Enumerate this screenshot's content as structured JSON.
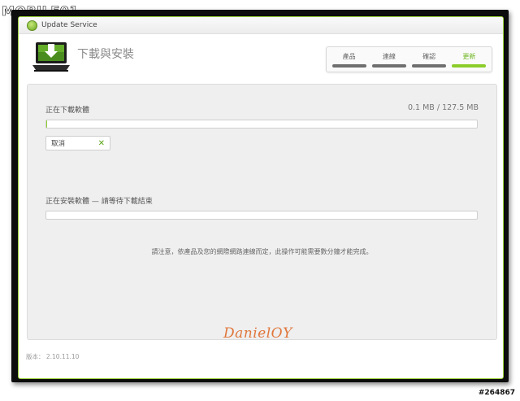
{
  "watermark": {
    "site_logo_text": "MOBILE01",
    "id_text": "#264867"
  },
  "window": {
    "title": "Update Service"
  },
  "header": {
    "page_title": "下載與安裝",
    "steps": [
      {
        "label": "產品",
        "active": false
      },
      {
        "label": "連線",
        "active": false
      },
      {
        "label": "確認",
        "active": false
      },
      {
        "label": "更新",
        "active": true
      }
    ],
    "colors": {
      "accent": "#8ccd2b",
      "inactive": "#6f6f6f"
    }
  },
  "download": {
    "label": "正在下載軟體",
    "size_text": "0.1 MB / 127.5 MB",
    "progress": 0.001,
    "cancel_label": "取消"
  },
  "install": {
    "label": "正在安裝軟體 — 請等待下載結束",
    "progress": 0
  },
  "notice": "請注意，依產品及您的網際網路連線而定，此操作可能需要數分鐘才能完成。",
  "signature": "DanielOY",
  "version_text": "版本： 2.10.11.10"
}
